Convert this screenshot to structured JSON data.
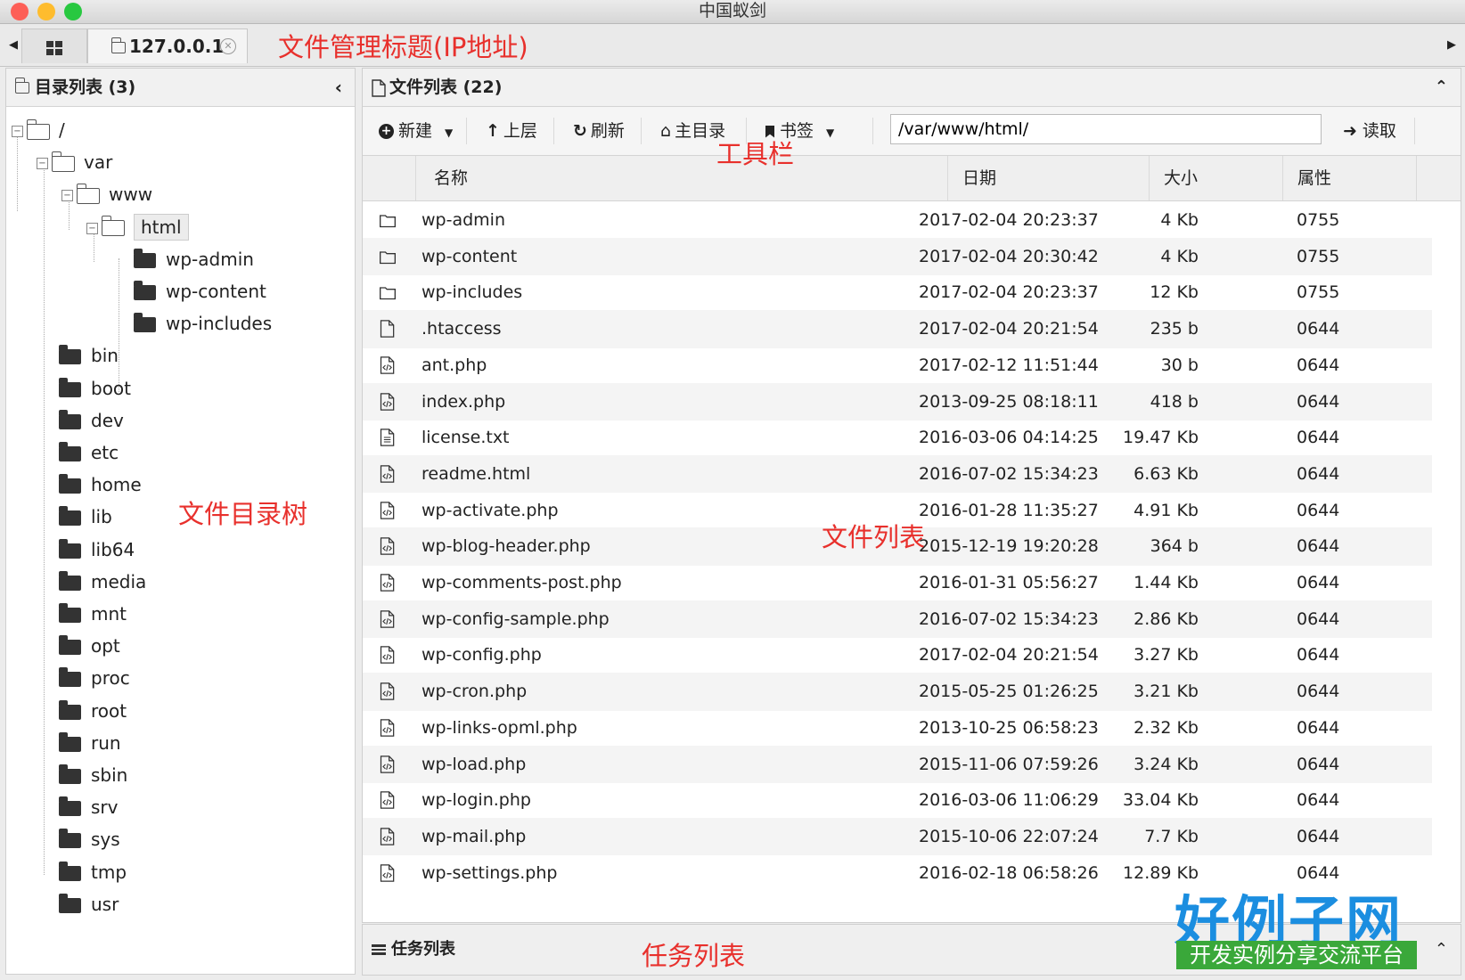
{
  "window": {
    "title": "中国蚁剑"
  },
  "tabs": {
    "home_icon": "grid-icon",
    "ip_tab_label": "127.0.0.1"
  },
  "annotations": {
    "tab_title": "文件管理标题(IP地址)",
    "toolbar": "工具栏",
    "tree": "文件目录树",
    "file_list": "文件列表",
    "task_list": "任务列表"
  },
  "dir_panel": {
    "title": "目录列表 (3)",
    "tree": [
      {
        "label": "/"
      },
      {
        "label": "var"
      },
      {
        "label": "www"
      },
      {
        "label": "html"
      },
      {
        "label": "wp-admin"
      },
      {
        "label": "wp-content"
      },
      {
        "label": "wp-includes"
      },
      {
        "label": "bin"
      },
      {
        "label": "boot"
      },
      {
        "label": "dev"
      },
      {
        "label": "etc"
      },
      {
        "label": "home"
      },
      {
        "label": "lib"
      },
      {
        "label": "lib64"
      },
      {
        "label": "media"
      },
      {
        "label": "mnt"
      },
      {
        "label": "opt"
      },
      {
        "label": "proc"
      },
      {
        "label": "root"
      },
      {
        "label": "run"
      },
      {
        "label": "sbin"
      },
      {
        "label": "srv"
      },
      {
        "label": "sys"
      },
      {
        "label": "tmp"
      },
      {
        "label": "usr"
      }
    ]
  },
  "file_panel": {
    "title": "文件列表 (22)",
    "toolbar": {
      "new": "新建",
      "up": "上层",
      "refresh": "刷新",
      "home": "主目录",
      "bookmark": "书签",
      "path": "/var/www/html/",
      "read": "读取"
    },
    "columns": {
      "name": "名称",
      "date": "日期",
      "size": "大小",
      "attr": "属性"
    },
    "rows": [
      {
        "type": "folder",
        "name": "wp-admin",
        "date": "2017-02-04 20:23:37",
        "size": "4 Kb",
        "attr": "0755"
      },
      {
        "type": "folder",
        "name": "wp-content",
        "date": "2017-02-04 20:30:42",
        "size": "4 Kb",
        "attr": "0755"
      },
      {
        "type": "folder",
        "name": "wp-includes",
        "date": "2017-02-04 20:23:37",
        "size": "12 Kb",
        "attr": "0755"
      },
      {
        "type": "file",
        "name": ".htaccess",
        "date": "2017-02-04 20:21:54",
        "size": "235 b",
        "attr": "0644"
      },
      {
        "type": "code",
        "name": "ant.php",
        "date": "2017-02-12 11:51:44",
        "size": "30 b",
        "attr": "0644"
      },
      {
        "type": "code",
        "name": "index.php",
        "date": "2013-09-25 08:18:11",
        "size": "418 b",
        "attr": "0644"
      },
      {
        "type": "text",
        "name": "license.txt",
        "date": "2016-03-06 04:14:25",
        "size": "19.47 Kb",
        "attr": "0644"
      },
      {
        "type": "code",
        "name": "readme.html",
        "date": "2016-07-02 15:34:23",
        "size": "6.63 Kb",
        "attr": "0644"
      },
      {
        "type": "code",
        "name": "wp-activate.php",
        "date": "2016-01-28 11:35:27",
        "size": "4.91 Kb",
        "attr": "0644"
      },
      {
        "type": "code",
        "name": "wp-blog-header.php",
        "date": "2015-12-19 19:20:28",
        "size": "364 b",
        "attr": "0644"
      },
      {
        "type": "code",
        "name": "wp-comments-post.php",
        "date": "2016-01-31 05:56:27",
        "size": "1.44 Kb",
        "attr": "0644"
      },
      {
        "type": "code",
        "name": "wp-config-sample.php",
        "date": "2016-07-02 15:34:23",
        "size": "2.86 Kb",
        "attr": "0644"
      },
      {
        "type": "code",
        "name": "wp-config.php",
        "date": "2017-02-04 20:21:54",
        "size": "3.27 Kb",
        "attr": "0644"
      },
      {
        "type": "code",
        "name": "wp-cron.php",
        "date": "2015-05-25 01:26:25",
        "size": "3.21 Kb",
        "attr": "0644"
      },
      {
        "type": "code",
        "name": "wp-links-opml.php",
        "date": "2013-10-25 06:58:23",
        "size": "2.32 Kb",
        "attr": "0644"
      },
      {
        "type": "code",
        "name": "wp-load.php",
        "date": "2015-11-06 07:59:26",
        "size": "3.24 Kb",
        "attr": "0644"
      },
      {
        "type": "code",
        "name": "wp-login.php",
        "date": "2016-03-06 11:06:29",
        "size": "33.04 Kb",
        "attr": "0644"
      },
      {
        "type": "code",
        "name": "wp-mail.php",
        "date": "2015-10-06 22:07:24",
        "size": "7.7 Kb",
        "attr": "0644"
      },
      {
        "type": "code",
        "name": "wp-settings.php",
        "date": "2016-02-18 06:58:26",
        "size": "12.89 Kb",
        "attr": "0644"
      }
    ]
  },
  "task_panel": {
    "title": "任务列表"
  },
  "watermark": {
    "logo": "好例子网",
    "slogan": "开发实例分享交流平台"
  },
  "colors": {
    "annotation": "#e8302c",
    "logo_blue": "#1b8ee0",
    "logo_green": "#3aa83a"
  }
}
